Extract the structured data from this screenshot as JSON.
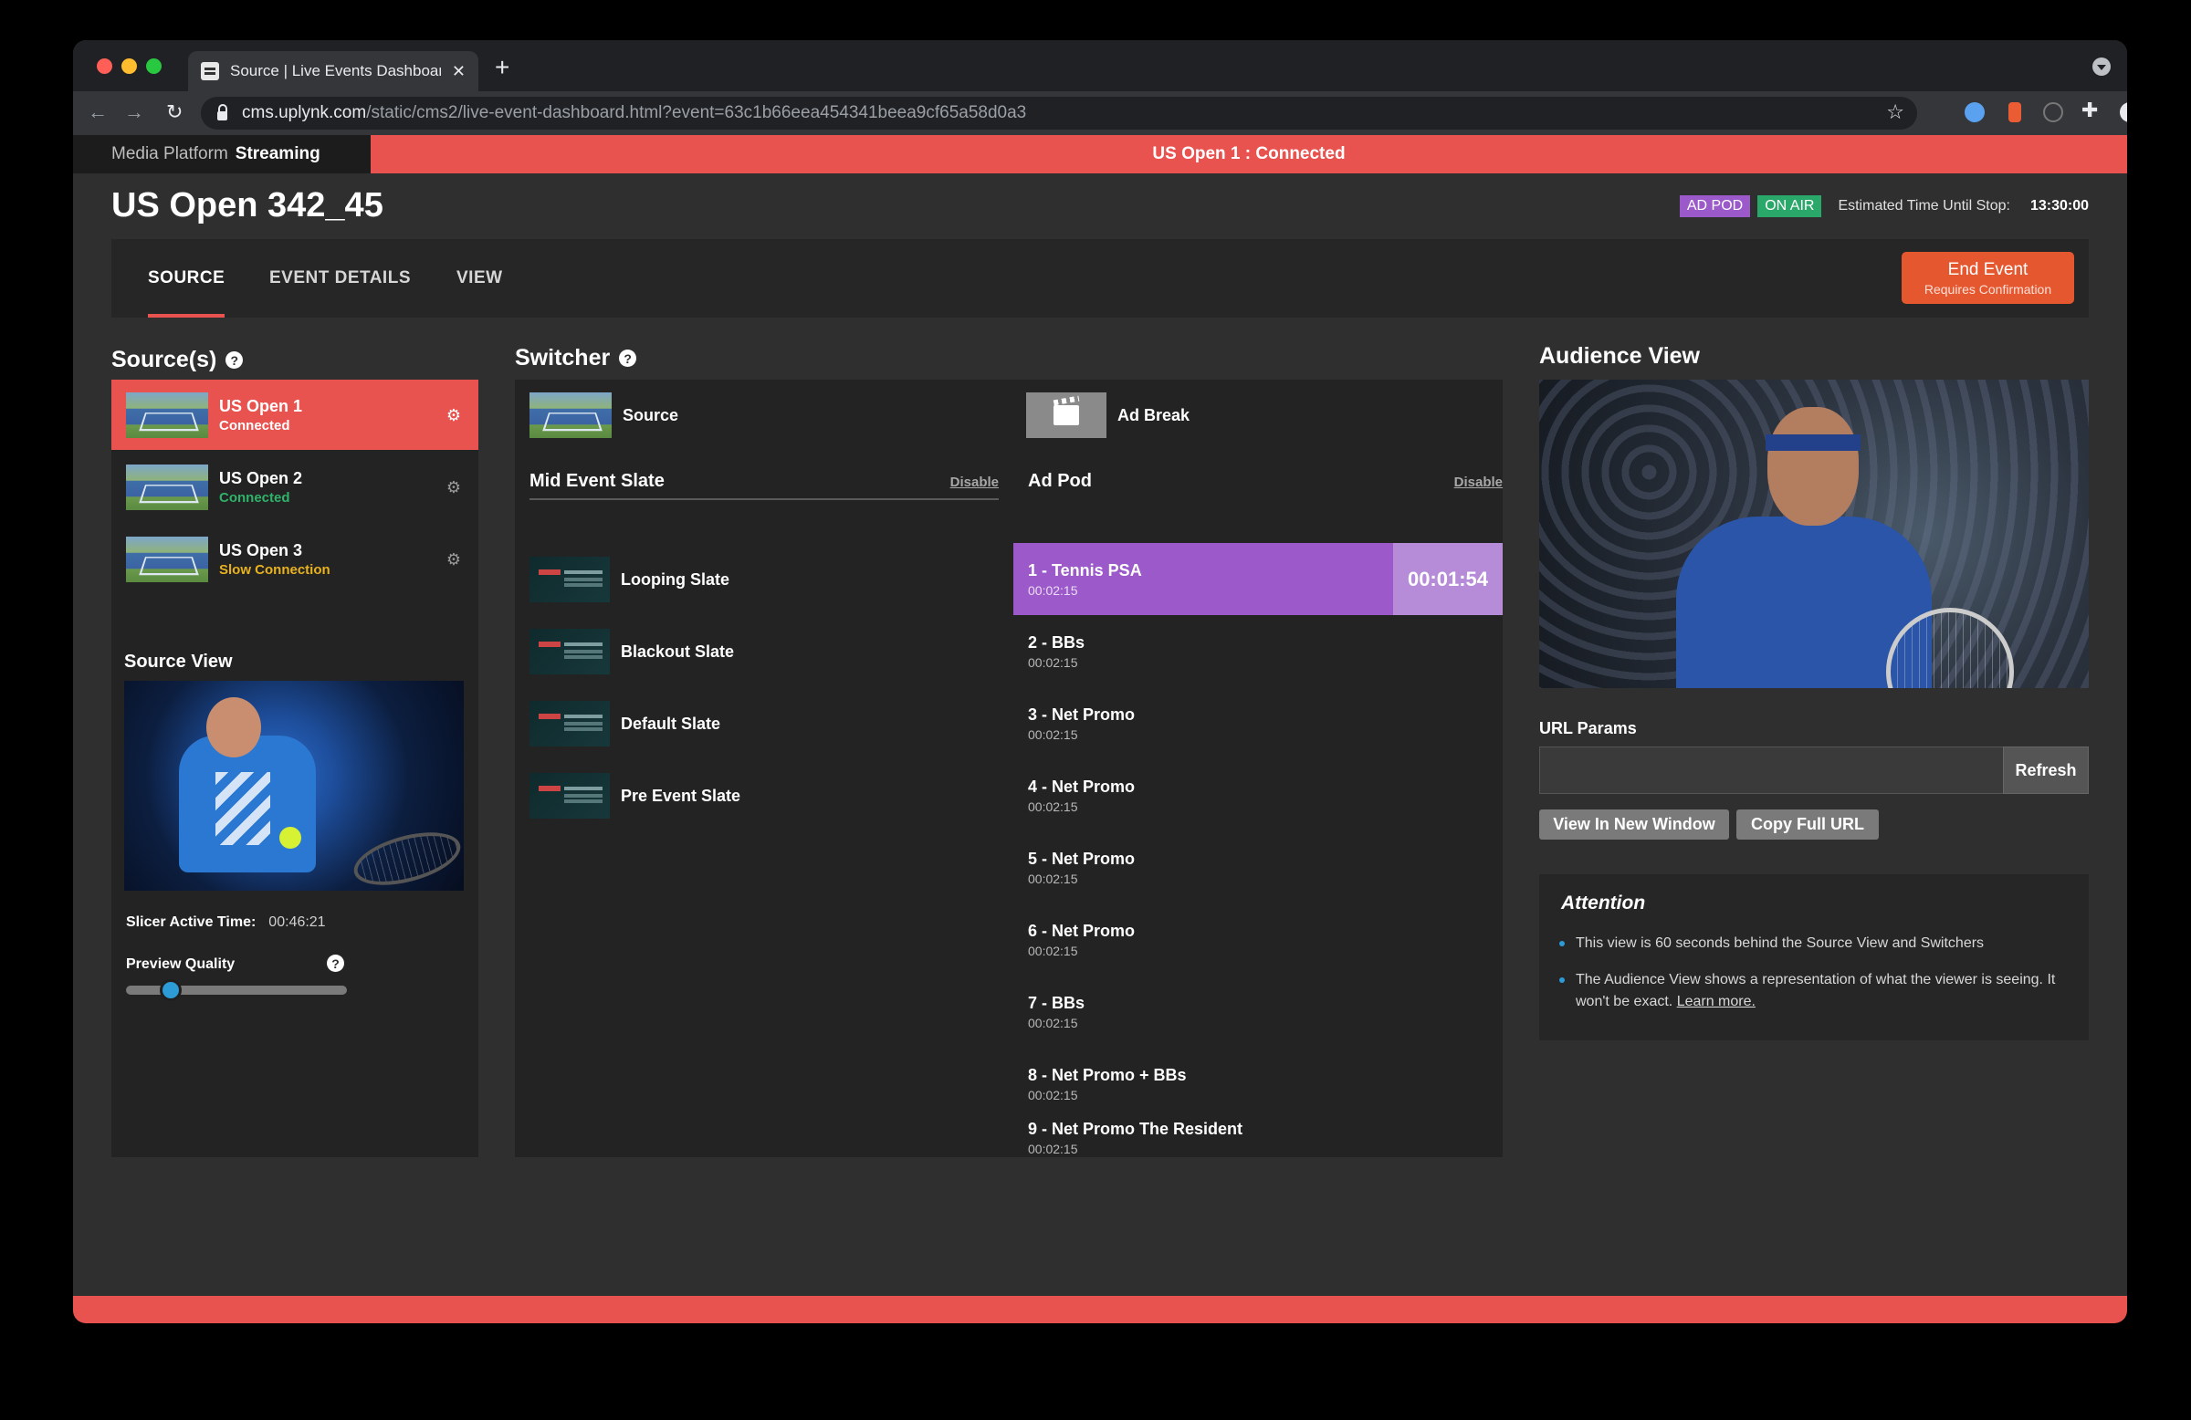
{
  "browser": {
    "tab_title": "Source | Live Events Dashboard",
    "new_tab": "+",
    "tab_close": "✕",
    "url_host": "cms.uplynk.com",
    "url_path": "/static/cms2/live-event-dashboard.html?event=63c1b66eea454341beea9cf65a58d0a3"
  },
  "app": {
    "brand_light": "Media Platform",
    "brand_bold": "Streaming",
    "status_banner": "US Open 1 : Connected",
    "event_title": "US Open 342_45",
    "badge_adpod": "AD POD",
    "badge_onair": "ON AIR",
    "etus_label": "Estimated Time Until Stop:",
    "etus_value": "13:30:00"
  },
  "tabs": {
    "source": "SOURCE",
    "details": "EVENT DETAILS",
    "view": "VIEW"
  },
  "end_event": {
    "label": "End Event",
    "sublabel": "Requires Confirmation"
  },
  "sources": {
    "title": "Source(s)",
    "items": [
      {
        "name": "US Open 1",
        "status": "Connected",
        "status_color": "#ffffff"
      },
      {
        "name": "US Open 2",
        "status": "Connected",
        "status_color": "#2fb36a"
      },
      {
        "name": "US Open 3",
        "status": "Slow Connection",
        "status_color": "#e8b21f"
      }
    ],
    "source_view_title": "Source View",
    "slicer_label": "Slicer Active Time:",
    "slicer_value": "00:46:21",
    "preview_label": "Preview Quality",
    "preview_quality": 0.17
  },
  "switcher": {
    "title": "Switcher",
    "source_label": "Source",
    "adbreak_label": "Ad Break",
    "mid_event_title": "Mid Event Slate",
    "mid_event_disable": "Disable",
    "adpod_title": "Ad Pod",
    "adpod_disable": "Disable",
    "slates": [
      "Looping Slate",
      "Blackout Slate",
      "Default Slate",
      "Pre Event Slate"
    ],
    "adpod": [
      {
        "name": "1 - Tennis PSA",
        "duration": "00:02:15",
        "timer": "00:01:54"
      },
      {
        "name": "2 - BBs",
        "duration": "00:02:15"
      },
      {
        "name": "3 - Net Promo",
        "duration": "00:02:15"
      },
      {
        "name": "4 - Net Promo",
        "duration": "00:02:15"
      },
      {
        "name": "5 - Net Promo",
        "duration": "00:02:15"
      },
      {
        "name": "6 - Net Promo",
        "duration": "00:02:15"
      },
      {
        "name": "7 - BBs",
        "duration": "00:02:15"
      },
      {
        "name": "8 - Net Promo + BBs",
        "duration": "00:02:15"
      },
      {
        "name": "9 - Net Promo The Resident",
        "duration": "00:02:15"
      }
    ]
  },
  "audience": {
    "title": "Audience View",
    "url_params_label": "URL Params",
    "url_params_value": "",
    "refresh": "Refresh",
    "view_new_window": "View In New Window",
    "copy_url": "Copy Full URL",
    "attention_title": "Attention",
    "attention_1": "This view is 60 seconds behind the Source View and Switchers",
    "attention_2": "The Audience View shows a representation of what the viewer is seeing. It won't be exact.",
    "learn_more": "Learn more."
  },
  "colors": {
    "accent_red": "#e8524f",
    "adpod_purple": "#9b59c9",
    "onair_green": "#2aa86a",
    "end_event_orange": "#e5572f"
  }
}
